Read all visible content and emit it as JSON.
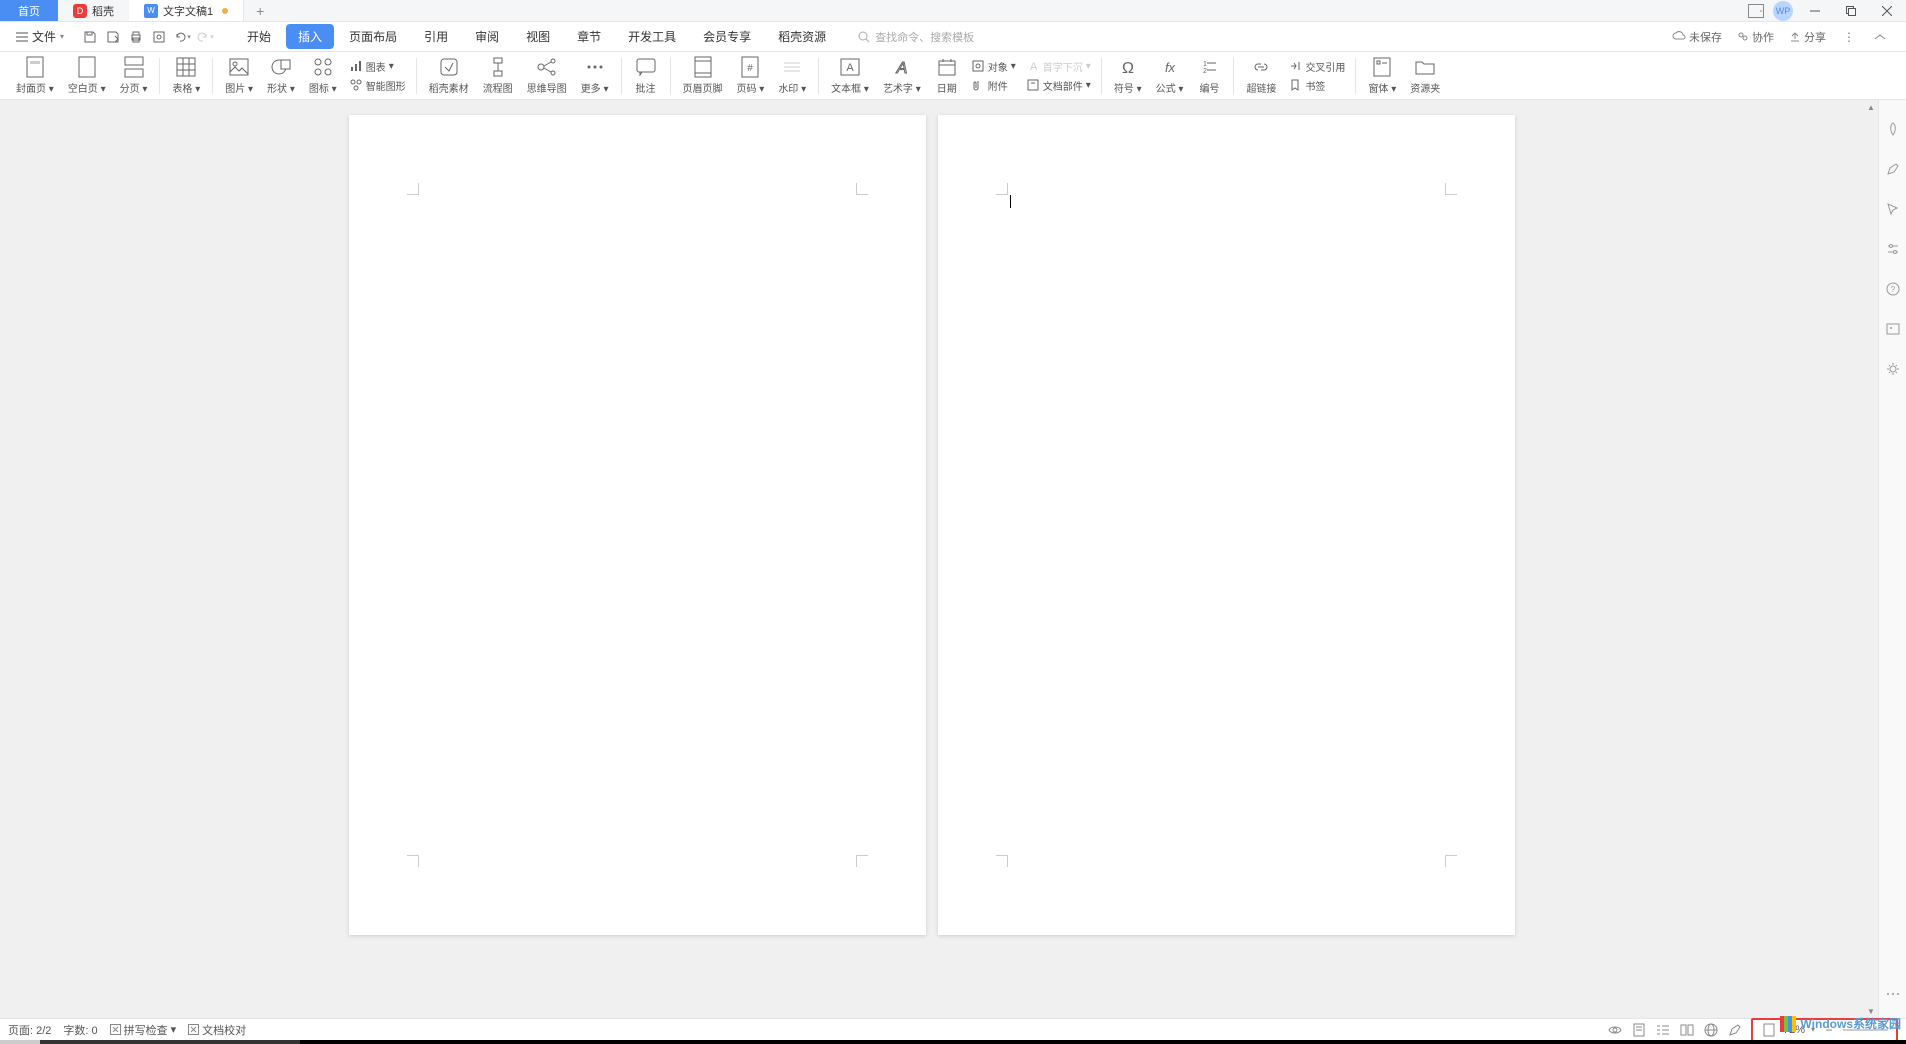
{
  "titlebar": {
    "tabs": {
      "home": "首页",
      "daoke": "稻壳",
      "doc": "文字文稿1"
    },
    "avatar": "WP"
  },
  "menubar": {
    "file": "文件",
    "tabs": [
      "开始",
      "插入",
      "页面布局",
      "引用",
      "审阅",
      "视图",
      "章节",
      "开发工具",
      "会员专享",
      "稻壳资源"
    ],
    "active_tab_index": 1,
    "search_placeholder": "查找命令、搜索模板",
    "unsaved": "未保存",
    "collab": "协作",
    "share": "分享"
  },
  "ribbon": {
    "buttons": [
      {
        "label": "封面页",
        "drop": true
      },
      {
        "label": "空白页",
        "drop": true
      },
      {
        "label": "分页",
        "drop": true
      },
      {
        "label": "表格",
        "drop": true
      },
      {
        "label": "图片",
        "drop": true
      },
      {
        "label": "形状",
        "drop": true
      },
      {
        "label": "图标",
        "drop": true
      },
      {
        "label": "智能图形"
      },
      {
        "label": "稻壳素材"
      },
      {
        "label": "流程图"
      },
      {
        "label": "思维导图"
      },
      {
        "label": "更多",
        "drop": true
      },
      {
        "label": "批注"
      },
      {
        "label": "页眉页脚"
      },
      {
        "label": "页码",
        "drop": true
      },
      {
        "label": "水印",
        "drop": true
      },
      {
        "label": "文本框",
        "drop": true
      },
      {
        "label": "艺术字",
        "drop": true
      },
      {
        "label": "日期"
      },
      {
        "label": "符号",
        "drop": true
      },
      {
        "label": "公式",
        "drop": true
      },
      {
        "label": "编号"
      },
      {
        "label": "超链接"
      },
      {
        "label": "窗体",
        "drop": true
      },
      {
        "label": "资源夹"
      }
    ],
    "small": {
      "chart": "图表",
      "object": "对象",
      "attachment": "附件",
      "docparts": "文档部件",
      "dropcap": "首字下沉",
      "crossref": "交叉引用",
      "bookmark": "书签"
    }
  },
  "statusbar": {
    "page": "页面: 2/2",
    "words": "字数: 0",
    "spellcheck": "拼写检查",
    "proofread": "文档校对",
    "zoom": "72%"
  },
  "watermark_text": "indows系统家园"
}
